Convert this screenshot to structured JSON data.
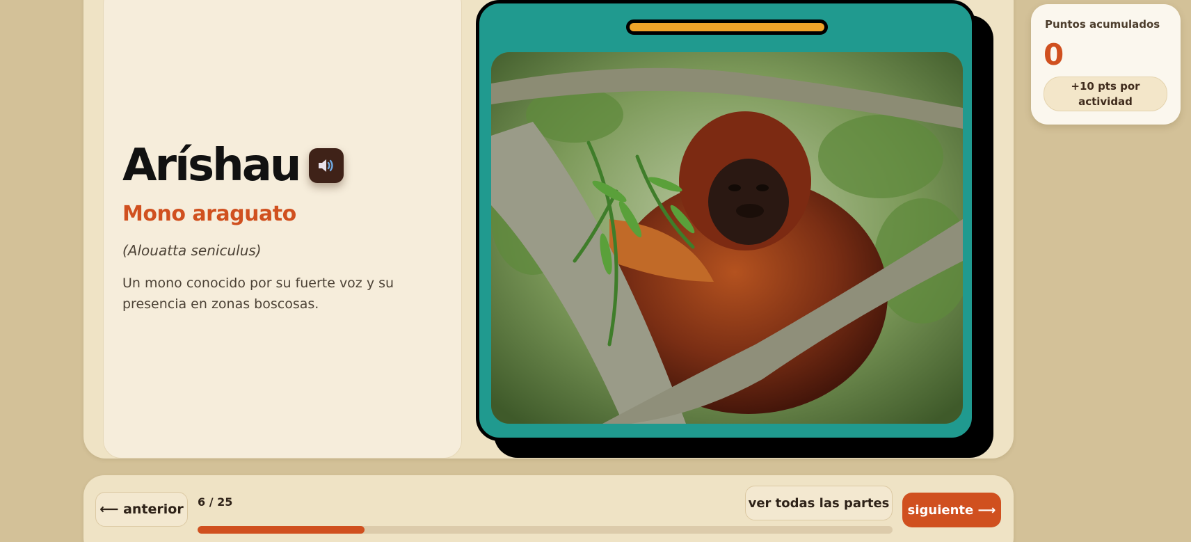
{
  "card": {
    "word": "Aríshau",
    "sound_icon": "speaker-icon",
    "translation": "Mono araguato",
    "scientific_name": "(Alouatta seniculus)",
    "description": "Un mono conocido por su fuerte voz y su presencia en zonas boscosas."
  },
  "points": {
    "label": "Puntos acumulados",
    "value": "0",
    "chip": "+10 pts por actividad"
  },
  "nav": {
    "prev_label": "⟵ anterior",
    "progress_text": "6 / 25",
    "progress_fraction": 0.24,
    "all_label": "ver todas las partes",
    "next_label": "siguiente ⟶"
  },
  "colors": {
    "accent": "#d0501f",
    "frame_teal": "#209a8f",
    "frame_bar": "#f0a329",
    "sound_button": "#3f2218"
  }
}
